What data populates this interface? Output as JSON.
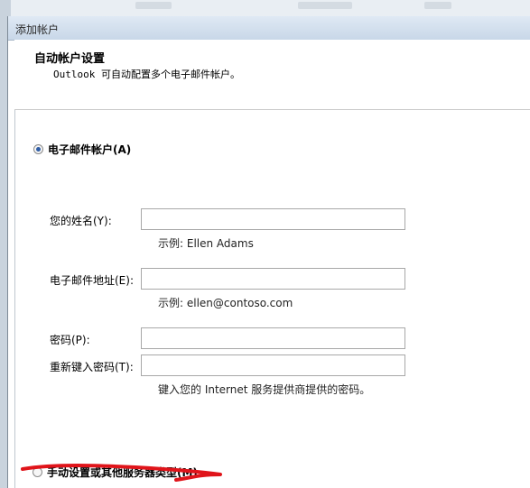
{
  "window": {
    "title": "添加帐户"
  },
  "header": {
    "title": "自动帐户设置",
    "subtitle": "Outlook 可自动配置多个电子邮件帐户。"
  },
  "options": {
    "email_account": {
      "label": "电子邮件帐户(A)",
      "selected": true
    },
    "manual": {
      "label": "手动设置或其他服务器类型(M)",
      "selected": false
    }
  },
  "form": {
    "name": {
      "label": "您的姓名(Y):",
      "value": "",
      "hint": "示例: Ellen Adams"
    },
    "email": {
      "label": "电子邮件地址(E):",
      "value": "",
      "hint": "示例: ellen@contoso.com"
    },
    "password": {
      "label": "密码(P):",
      "value": ""
    },
    "retype_password": {
      "label": "重新键入密码(T):",
      "value": "",
      "hint": "键入您的 Internet 服务提供商提供的密码。"
    }
  },
  "colors": {
    "annotation": "#e0141a",
    "radio_dot": "#2f5da6"
  }
}
